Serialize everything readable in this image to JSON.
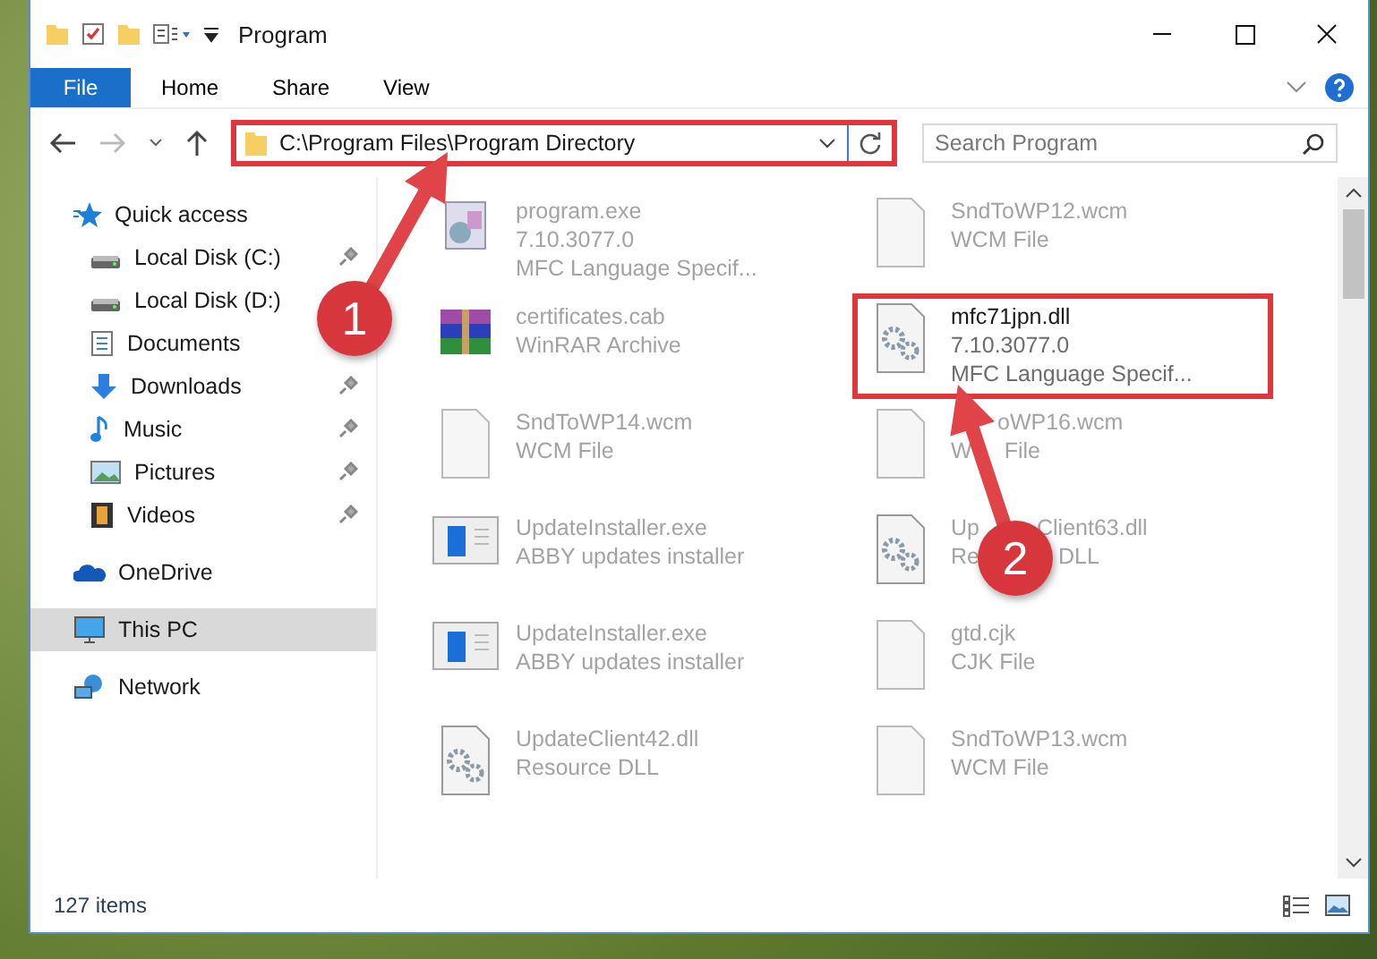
{
  "window": {
    "title": "Program"
  },
  "ribbon": {
    "tabs": [
      {
        "label": "File",
        "kind": "app-menu"
      },
      {
        "label": "Home",
        "kind": "tab"
      },
      {
        "label": "Share",
        "kind": "tab"
      },
      {
        "label": "View",
        "kind": "tab"
      }
    ]
  },
  "address": {
    "path": "C:\\Program Files\\Program Directory",
    "highlighted": true
  },
  "search": {
    "placeholder": "Search Program"
  },
  "sidebar": {
    "items": [
      {
        "label": "Quick access",
        "kind": "star",
        "selected": false,
        "children": [
          {
            "label": "Local Disk (C:)",
            "kind": "drive",
            "pinned": true,
            "selected": false
          },
          {
            "label": "Local Disk (D:)",
            "kind": "drive",
            "pinned": false,
            "selected": false
          },
          {
            "label": "Documents",
            "kind": "document",
            "pinned": false,
            "selected": false
          },
          {
            "label": "Downloads",
            "kind": "download",
            "pinned": true,
            "selected": false
          },
          {
            "label": "Music",
            "kind": "music",
            "pinned": true,
            "selected": false
          },
          {
            "label": "Pictures",
            "kind": "picture",
            "pinned": true,
            "selected": false
          },
          {
            "label": "Videos",
            "kind": "video",
            "pinned": true,
            "selected": false
          }
        ]
      },
      {
        "label": "OneDrive",
        "kind": "cloud",
        "selected": false
      },
      {
        "label": "This PC",
        "kind": "computer",
        "selected": true
      },
      {
        "label": "Network",
        "kind": "network",
        "selected": false
      }
    ]
  },
  "files": [
    {
      "name": [
        "program.exe"
      ],
      "lines": [
        [
          "7.10.3077.0"
        ],
        [
          "MFC Language Specif..."
        ]
      ],
      "kind": "installer",
      "highlighted": false
    },
    {
      "name": [
        "SndToWP12.wcm"
      ],
      "lines": [
        [
          "WCM File"
        ]
      ],
      "kind": "blank",
      "highlighted": false
    },
    {
      "name": [
        "certificates.cab"
      ],
      "lines": [
        [
          "WinRAR Archive"
        ]
      ],
      "kind": "archive",
      "highlighted": false
    },
    {
      "name": [
        "mfc71jpn.dll"
      ],
      "lines": [
        [
          "7.10.3077.0"
        ],
        [
          "MFC Language Specif..."
        ]
      ],
      "kind": "gear",
      "highlighted": true
    },
    {
      "name": [
        "SndToWP14.wcm"
      ],
      "lines": [
        [
          "WCM File"
        ]
      ],
      "kind": "blank",
      "highlighted": false
    },
    {
      "name": [
        "oWP16.wcm"
      ],
      "lines": [
        [
          "W",
          "File"
        ]
      ],
      "kind": "blank",
      "highlighted": false
    },
    {
      "name": [
        "UpdateInstaller.exe"
      ],
      "lines": [
        [
          "ABBY updates installer"
        ]
      ],
      "kind": "window",
      "highlighted": false
    },
    {
      "name": [
        "Up",
        "Client63.dll"
      ],
      "lines": [
        [
          "Re",
          "DLL"
        ]
      ],
      "kind": "gear",
      "highlighted": false
    },
    {
      "name": [
        "UpdateInstaller.exe"
      ],
      "lines": [
        [
          "ABBY updates installer"
        ]
      ],
      "kind": "window",
      "highlighted": false
    },
    {
      "name": [
        "gtd.cjk"
      ],
      "lines": [
        [
          "CJK File"
        ]
      ],
      "kind": "blank",
      "highlighted": false
    },
    {
      "name": [
        "UpdateClient42.dll"
      ],
      "lines": [
        [
          "Resource DLL"
        ]
      ],
      "kind": "gear",
      "highlighted": false
    },
    {
      "name": [
        "SndToWP13.wcm"
      ],
      "lines": [
        [
          "WCM File"
        ]
      ],
      "kind": "blank",
      "highlighted": false
    }
  ],
  "status_bar": {
    "count": "127 items"
  },
  "annotations": [
    {
      "label": "1"
    },
    {
      "label": "2"
    }
  ]
}
